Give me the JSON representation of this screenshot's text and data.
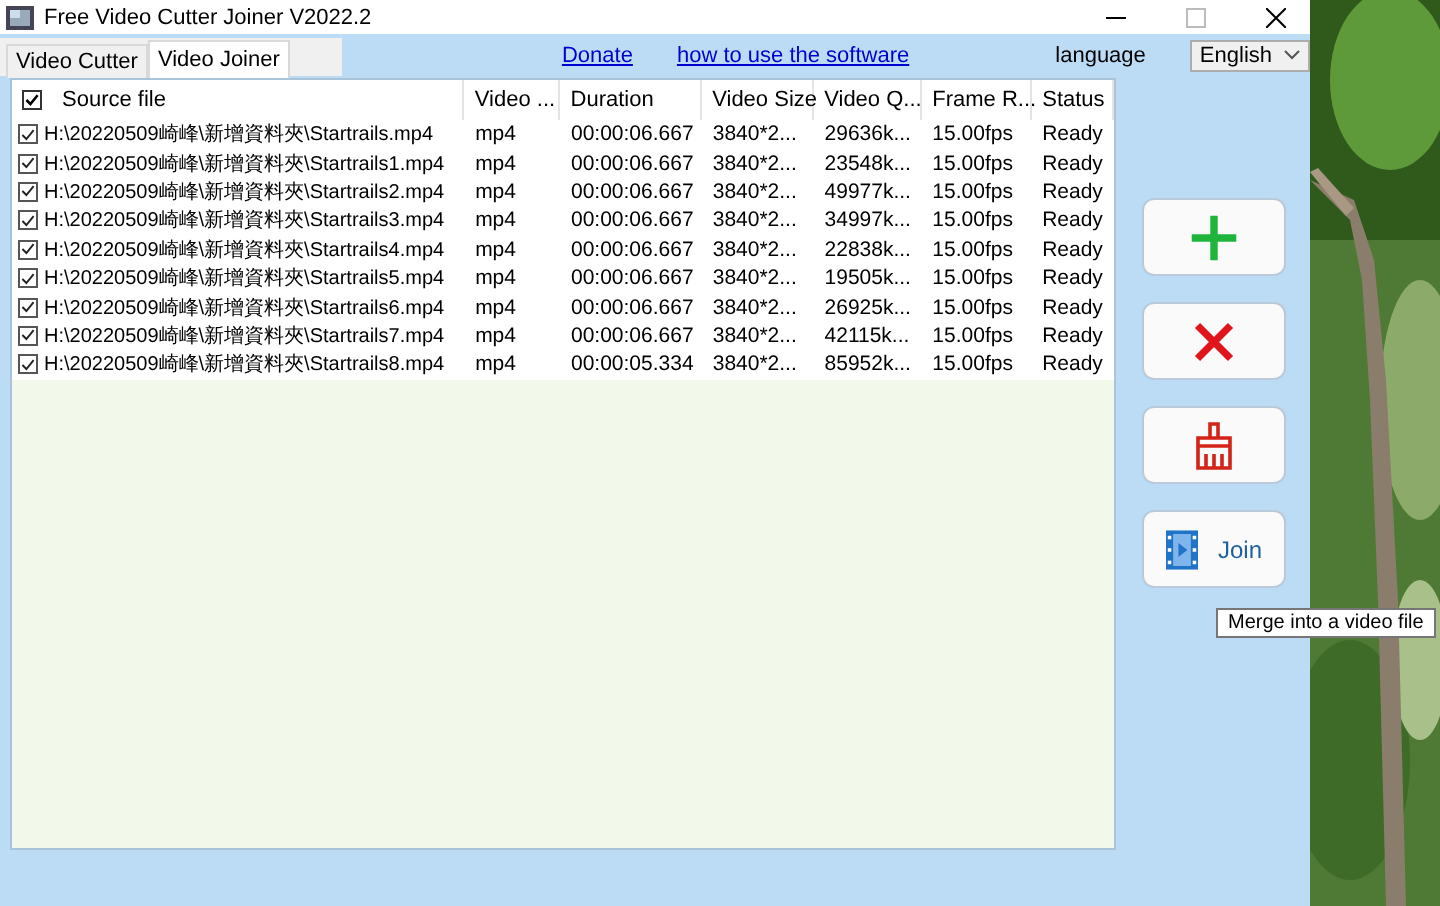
{
  "window": {
    "title": "Free Video Cutter Joiner V2022.2"
  },
  "tabs": [
    {
      "label": "Video Cutter",
      "selected": false
    },
    {
      "label": "Video Joiner",
      "selected": true
    }
  ],
  "links": [
    "Donate",
    "how to use the software"
  ],
  "language": {
    "label": "language",
    "value": "English"
  },
  "table": {
    "header_checked": true,
    "columns": [
      "Source file",
      "Video ...",
      "Duration",
      "Video Size",
      "Video Q...",
      "Frame R...",
      "Status"
    ],
    "rows": [
      {
        "checked": true,
        "cells": [
          "H:\\20220509崎峰\\新增資料夾\\Startrails.mp4",
          "mp4",
          "00:00:06.667",
          "3840*2...",
          "29636k...",
          "15.00fps",
          "Ready"
        ]
      },
      {
        "checked": true,
        "cells": [
          "H:\\20220509崎峰\\新增資料夾\\Startrails1.mp4",
          "mp4",
          "00:00:06.667",
          "3840*2...",
          "23548k...",
          "15.00fps",
          "Ready"
        ]
      },
      {
        "checked": true,
        "cells": [
          "H:\\20220509崎峰\\新增資料夾\\Startrails2.mp4",
          "mp4",
          "00:00:06.667",
          "3840*2...",
          "49977k...",
          "15.00fps",
          "Ready"
        ]
      },
      {
        "checked": true,
        "cells": [
          "H:\\20220509崎峰\\新增資料夾\\Startrails3.mp4",
          "mp4",
          "00:00:06.667",
          "3840*2...",
          "34997k...",
          "15.00fps",
          "Ready"
        ]
      },
      {
        "checked": true,
        "cells": [
          "H:\\20220509崎峰\\新增資料夾\\Startrails4.mp4",
          "mp4",
          "00:00:06.667",
          "3840*2...",
          "22838k...",
          "15.00fps",
          "Ready"
        ]
      },
      {
        "checked": true,
        "cells": [
          "H:\\20220509崎峰\\新增資料夾\\Startrails5.mp4",
          "mp4",
          "00:00:06.667",
          "3840*2...",
          "19505k...",
          "15.00fps",
          "Ready"
        ]
      },
      {
        "checked": true,
        "cells": [
          "H:\\20220509崎峰\\新增資料夾\\Startrails6.mp4",
          "mp4",
          "00:00:06.667",
          "3840*2...",
          "26925k...",
          "15.00fps",
          "Ready"
        ]
      },
      {
        "checked": true,
        "cells": [
          "H:\\20220509崎峰\\新增資料夾\\Startrails7.mp4",
          "mp4",
          "00:00:06.667",
          "3840*2...",
          "42115k...",
          "15.00fps",
          "Ready"
        ]
      },
      {
        "checked": true,
        "cells": [
          "H:\\20220509崎峰\\新增資料夾\\Startrails8.mp4",
          "mp4",
          "00:00:05.334",
          "3840*2...",
          "85952k...",
          "15.00fps",
          "Ready"
        ]
      }
    ]
  },
  "buttons": [
    {
      "kind": "add"
    },
    {
      "kind": "remove"
    },
    {
      "kind": "clear"
    },
    {
      "kind": "join",
      "label": "Join"
    }
  ],
  "tooltip": "Merge into a video file"
}
